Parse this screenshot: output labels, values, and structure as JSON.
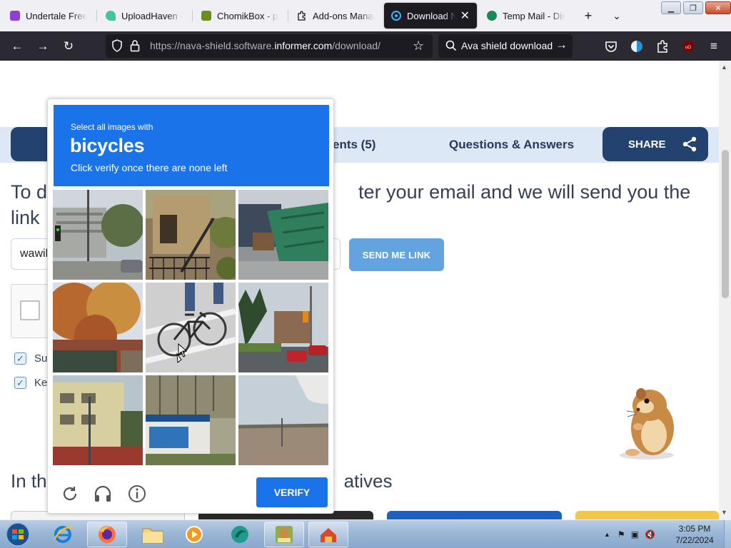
{
  "browser": {
    "tabs": [
      {
        "title": "Undertale Free D",
        "favicon_color": "#8f3fd1",
        "active": false
      },
      {
        "title": "UploadHaven - F",
        "favicon_color": "#43c49a",
        "active": false
      },
      {
        "title": "ChomikBox - pra",
        "favicon_color": "#6b8e23",
        "active": false
      },
      {
        "title": "Add-ons Manage",
        "favicon_color": "#15141a",
        "active": false
      },
      {
        "title": "Download Na",
        "favicon_color": "#36b6ff",
        "active": true
      },
      {
        "title": "Temp Mail - Disp",
        "favicon_color": "#1a8a5a",
        "active": false
      }
    ],
    "url_prefix": "https://nava-shield.software.",
    "url_host": "informer.com",
    "url_path": "/download/",
    "search_text": "Ava shield download"
  },
  "page": {
    "nav": {
      "comments_label": "ents (5)",
      "qa_label": "Questions & Answers",
      "share_label": "SHARE"
    },
    "headline_part1": "To d",
    "headline_part2": "ter your email and we will send you the",
    "headline_line2": "link",
    "email_value": "wawil",
    "send_button": "SEND ME LINK",
    "checkbox1_label": "Su",
    "checkbox2_label": "Ke",
    "alternatives_part1": "In th",
    "alternatives_part2": "atives"
  },
  "captcha": {
    "prompt": "Select all images with",
    "target_word": "bicycles",
    "instruction": "Click verify once there are none left",
    "verify_label": "VERIFY",
    "tiles": [
      {
        "subject": "street-office-building"
      },
      {
        "subject": "house-stairs"
      },
      {
        "subject": "green-dumpster"
      },
      {
        "subject": "autumn-trees"
      },
      {
        "subject": "bicycle"
      },
      {
        "subject": "street-traffic-light"
      },
      {
        "subject": "building-corner"
      },
      {
        "subject": "sign-board"
      },
      {
        "subject": "empty-lot"
      }
    ]
  },
  "taskbar": {
    "time": "3:05 PM",
    "date": "7/22/2024"
  }
}
